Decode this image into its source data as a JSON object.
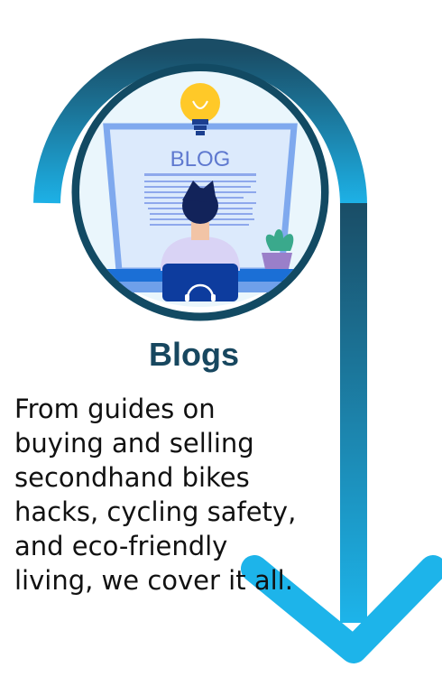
{
  "section": {
    "title": "Blogs",
    "body": "From guides on\nbuying and selling\nsecondhand bikes\nhacks, cycling safety,\nand eco-friendly\nliving, we cover it all."
  },
  "illustration": {
    "screen_label": "BLOG"
  },
  "colors": {
    "arrow_dark": "#1a4d66",
    "arrow_light": "#1db4ea",
    "title": "#17475f",
    "screen_frame": "#7fa9ee",
    "desk": "#1b6fd6"
  },
  "icons": [
    "lightbulb-icon",
    "monitor-icon",
    "person-icon",
    "plant-icon",
    "headset-icon",
    "down-arrow-icon"
  ]
}
